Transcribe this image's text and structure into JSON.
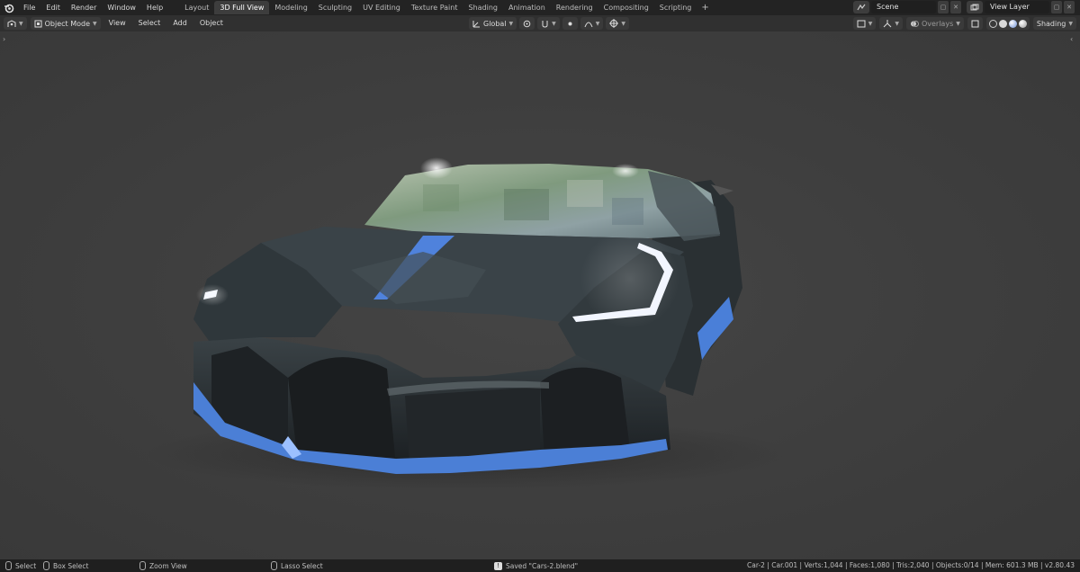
{
  "topbar": {
    "menu": [
      "File",
      "Edit",
      "Render",
      "Window",
      "Help"
    ],
    "tabs": [
      "Layout",
      "3D Full View",
      "Modeling",
      "Sculpting",
      "UV Editing",
      "Texture Paint",
      "Shading",
      "Animation",
      "Rendering",
      "Compositing",
      "Scripting"
    ],
    "active_tab": "3D Full View",
    "add_tab": "+",
    "scene": "Scene",
    "view_layer": "View Layer"
  },
  "viewport_header": {
    "mode": "Object Mode",
    "menus": [
      "View",
      "Select",
      "Add",
      "Object"
    ],
    "orientation": "Global",
    "overlays": "Overlays",
    "shading": "Shading"
  },
  "statusbar": {
    "select": "Select",
    "box_select": "Box Select",
    "zoom_view": "Zoom View",
    "lasso_select": "Lasso Select",
    "saved_message": "Saved \"Cars-2.blend\"",
    "stats": "Car-2 | Car.001 | Verts:1,044 | Faces:1,080 | Tris:2,040 | Objects:0/14 | Mem: 601.3 MB | v2.80.43"
  },
  "colors": {
    "accent_blue": "#4f7fd6",
    "active_tab_bg": "#3d3d3d",
    "viewport_bg": "#3f3f3f"
  }
}
